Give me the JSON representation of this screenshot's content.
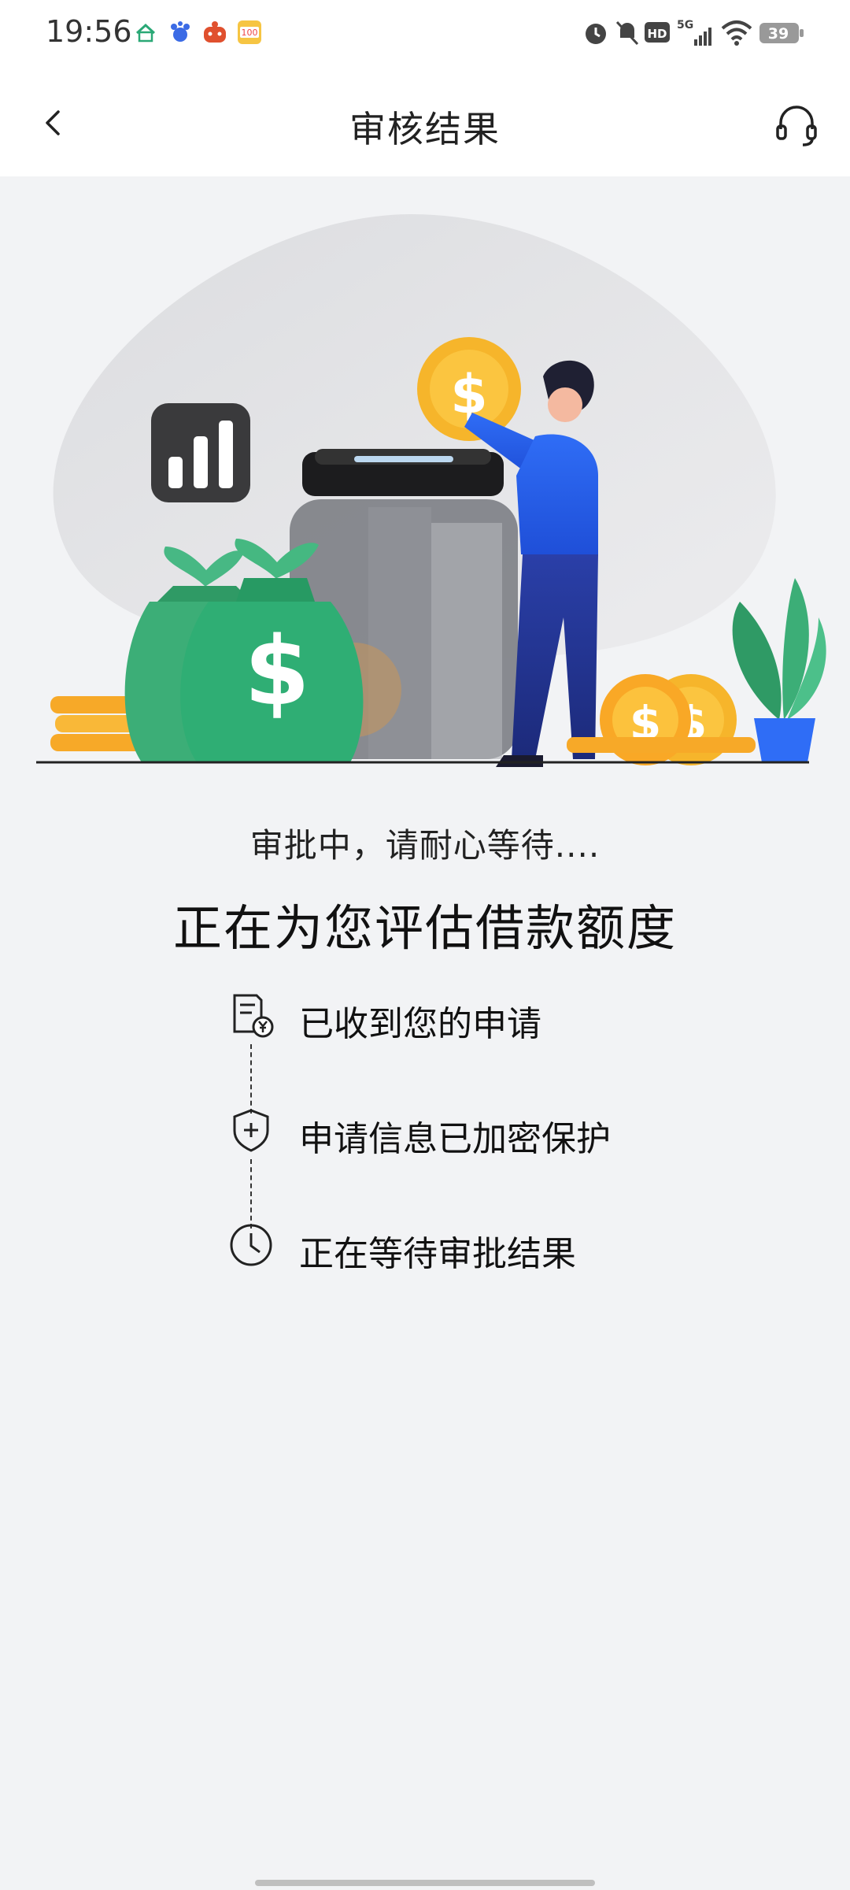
{
  "status_bar": {
    "time": "19:56",
    "network": "5G",
    "hd": "HD",
    "battery": "39",
    "icons": [
      "app-icon-1",
      "app-icon-2",
      "app-icon-3",
      "app-icon-4",
      "alarm-icon",
      "mute-icon",
      "hd-icon",
      "signal-icon",
      "wifi-icon",
      "battery-icon"
    ]
  },
  "header": {
    "title": "审核结果",
    "back_icon": "chevron-left-icon",
    "support_icon": "headset-icon"
  },
  "status": {
    "subtitle": "审批中，请耐心等待....",
    "headline": "正在为您评估借款额度"
  },
  "steps": [
    {
      "label": "已收到您的申请",
      "icon": "document-yen-icon"
    },
    {
      "label": "申请信息已加密保护",
      "icon": "shield-plus-icon"
    },
    {
      "label": "正在等待审批结果",
      "icon": "clock-icon"
    }
  ],
  "colors": {
    "accent_blue": "#2f6df6",
    "money_green": "#2fae74",
    "coin_gold": "#f7b731",
    "background": "#f2f3f5"
  }
}
